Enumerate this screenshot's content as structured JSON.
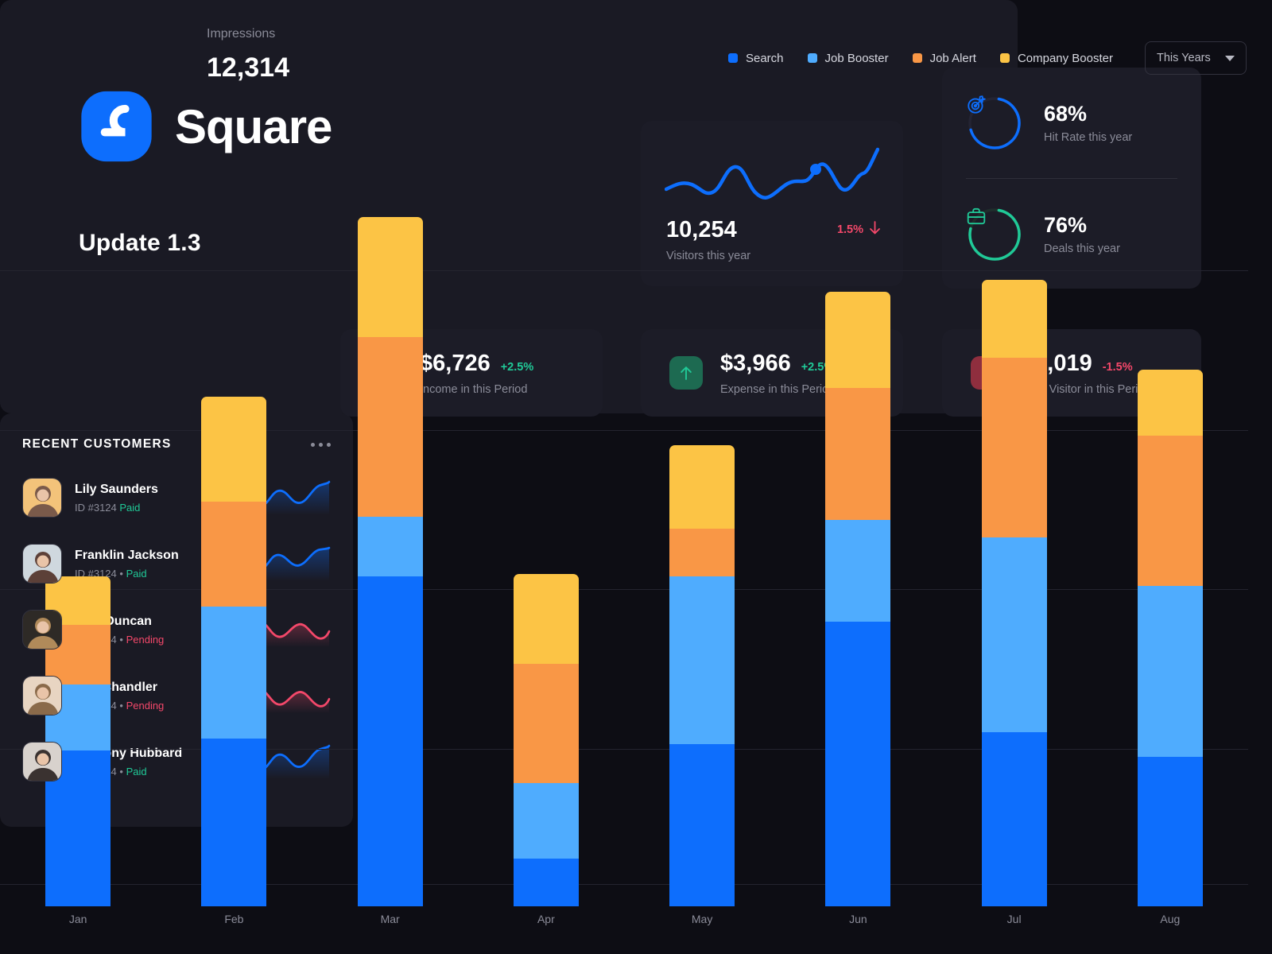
{
  "brand": {
    "name": "Square",
    "update": "Update 1.3"
  },
  "visitors_card": {
    "value": "10,254",
    "label": "Visitors this year",
    "delta": "1.5%",
    "delta_icon": "arrow-down-icon",
    "delta_color": "#f4486a"
  },
  "rate_card": {
    "rows": [
      {
        "value": "68%",
        "label": "Hit Rate this year",
        "percent": 68,
        "color": "#0d6efd",
        "icon": "target-icon"
      },
      {
        "value": "76%",
        "label": "Deals this year",
        "percent": 76,
        "color": "#20c997",
        "icon": "briefcase-icon"
      }
    ]
  },
  "kpis": [
    {
      "value": "$6,726",
      "delta": "+2.5%",
      "label": "Income in this Period",
      "dir": "up",
      "icon": "arrow-up-icon",
      "color": "#20c997"
    },
    {
      "value": "$3,966",
      "delta": "+2.5%",
      "label": "Expense in this Period",
      "dir": "up",
      "icon": "arrow-up-icon",
      "color": "#20c997"
    },
    {
      "value": "28,019",
      "delta": "-1.5%",
      "label": "Total Visitor in this Period",
      "dir": "down",
      "icon": "arrow-down-icon",
      "color": "#f4486a"
    }
  ],
  "chart_panel": {
    "title": "Impressions",
    "total": "12,314",
    "period_select": {
      "value": "This Years",
      "caret_icon": "chevron-down-icon"
    }
  },
  "chart_data": {
    "type": "bar",
    "title": "Impressions",
    "subtitle": "12,314",
    "stacked": true,
    "xlabel": "",
    "ylabel": "",
    "grid": true,
    "legend_position": "top-right",
    "categories": [
      "Jan",
      "Feb",
      "Mar",
      "Apr",
      "May",
      "Jun",
      "Jul",
      "Aug"
    ],
    "series": [
      {
        "name": "Search",
        "color": "#0d6efd",
        "values": [
          52,
          56,
          110,
          16,
          54,
          95,
          58,
          50
        ]
      },
      {
        "name": "Job Booster",
        "color": "#4facfe",
        "values": [
          22,
          44,
          20,
          25,
          56,
          34,
          65,
          57
        ]
      },
      {
        "name": "Job Alert",
        "color": "#f99746",
        "values": [
          20,
          35,
          60,
          40,
          16,
          44,
          60,
          50
        ]
      },
      {
        "name": "Company Booster",
        "color": "#fcc445",
        "values": [
          16,
          35,
          40,
          30,
          28,
          32,
          26,
          22
        ]
      }
    ],
    "ylim": [
      0,
      260
    ]
  },
  "customers_panel": {
    "title": "RECENT CUSTOMERS",
    "menu_icon": "more-horizontal-icon",
    "rows": [
      {
        "name": "Lily Saunders",
        "id": "ID #3124",
        "sep": "",
        "status": "Paid",
        "status_class": "st-paid",
        "trend_color": "#0d6efd"
      },
      {
        "name": "Franklin Jackson",
        "id": "ID #3124",
        "sep": "•",
        "status": "Paid",
        "status_class": "st-paid",
        "trend_color": "#0d6efd"
      },
      {
        "name": "Kyle Duncan",
        "id": "ID #3124",
        "sep": "•",
        "status": "Pending",
        "status_class": "st-pending",
        "trend_color": "#f4486a"
      },
      {
        "name": "Alta Chandler",
        "id": "ID #3124",
        "sep": "•",
        "status": "Pending",
        "status_class": "st-pending",
        "trend_color": "#f4486a"
      },
      {
        "name": "Anthony Hubbard",
        "id": "ID #3124",
        "sep": "•",
        "status": "Paid",
        "status_class": "st-paid",
        "trend_color": "#0d6efd"
      }
    ]
  },
  "legend": [
    {
      "label": "Search",
      "color": "#0d6efd"
    },
    {
      "label": "Job Booster",
      "color": "#4facfe"
    },
    {
      "label": "Job Alert",
      "color": "#f99746"
    },
    {
      "label": "Company Booster",
      "color": "#fcc445"
    }
  ]
}
